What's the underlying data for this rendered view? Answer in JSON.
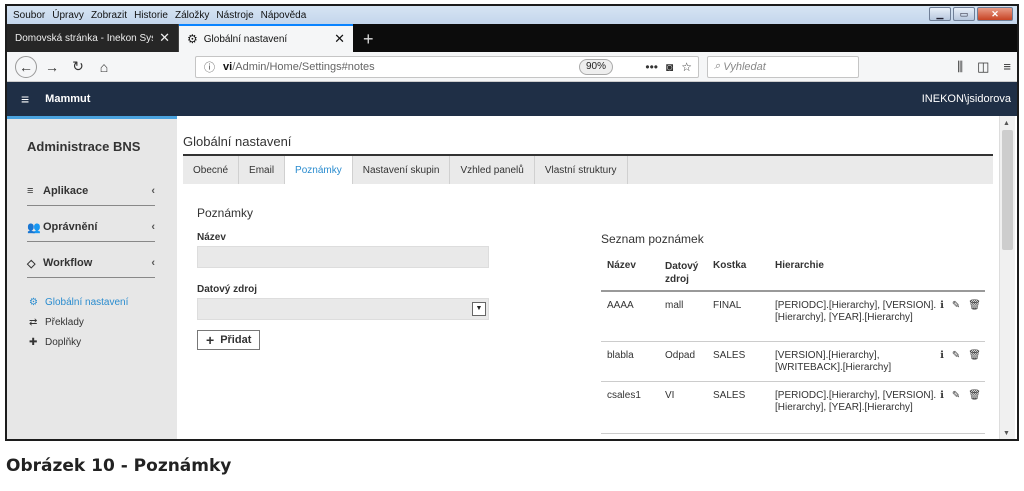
{
  "menubar": [
    "Soubor",
    "Úpravy",
    "Zobrazit",
    "Historie",
    "Záložky",
    "Nástroje",
    "Nápověda"
  ],
  "browser_tabs": [
    {
      "title": "Domovská stránka - Inekon Systems",
      "active": false
    },
    {
      "title": "Globální nastavení",
      "active": true
    }
  ],
  "url": {
    "host": "vi",
    "path": "/Admin/Home/Settings#notes"
  },
  "zoom": "90%",
  "search_placeholder": "Vyhledat",
  "app": {
    "brand": "Mammut",
    "user": "INEKON\\jsidorova"
  },
  "sidebar": {
    "title": "Administrace BNS",
    "sections": [
      {
        "label": "Aplikace",
        "icon": "list-icon"
      },
      {
        "label": "Oprávnění",
        "icon": "users-icon"
      },
      {
        "label": "Workflow",
        "icon": "diamond-icon"
      }
    ],
    "links": [
      {
        "label": "Globální nastavení",
        "icon": "gear-icon",
        "active": true
      },
      {
        "label": "Překlady",
        "icon": "exchange-icon",
        "active": false
      },
      {
        "label": "Doplňky",
        "icon": "puzzle-icon",
        "active": false
      }
    ]
  },
  "main": {
    "title": "Globální nastavení",
    "tabs": [
      "Obecné",
      "Email",
      "Poznámky",
      "Nastavení skupin",
      "Vzhled panelů",
      "Vlastní struktury"
    ],
    "active_tab": "Poznámky",
    "form": {
      "title": "Poznámky",
      "name_label": "Název",
      "source_label": "Datový zdroj",
      "add_label": "Přidat"
    },
    "list": {
      "title": "Seznam poznámek",
      "headers": [
        "Název",
        "Datový\nzdroj",
        "Kostka",
        "Hierarchie"
      ],
      "rows": [
        {
          "name": "AAAA",
          "source": "mall",
          "cube": "FINAL",
          "hierarchy": "[PERIODC].[Hierarchy], [VERSION].[Hierarchy], [YEAR].[Hierarchy]"
        },
        {
          "name": "blabla",
          "source": "Odpad",
          "cube": "SALES",
          "hierarchy": "[VERSION].[Hierarchy], [WRITEBACK].[Hierarchy]"
        },
        {
          "name": "csales1",
          "source": "VI",
          "cube": "SALES",
          "hierarchy": "[PERIODC].[Hierarchy], [VERSION].[Hierarchy], [YEAR].[Hierarchy]"
        }
      ]
    }
  },
  "caption": "Obrázek 10 - Poznámky"
}
